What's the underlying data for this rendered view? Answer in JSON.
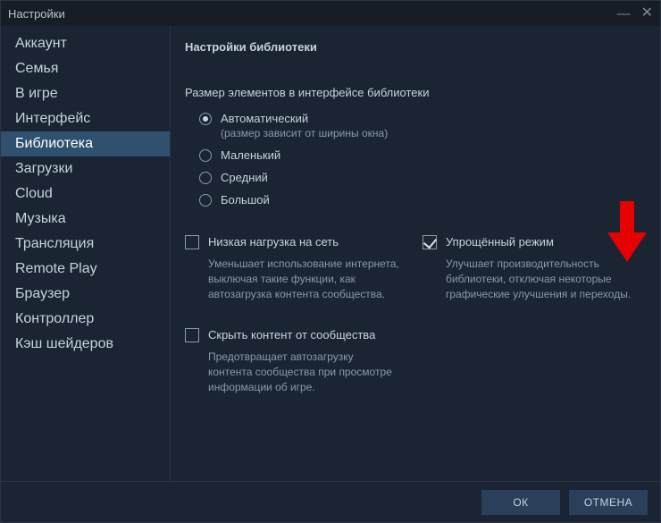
{
  "titlebar": {
    "title": "Настройки"
  },
  "sidebar": {
    "items": [
      {
        "label": "Аккаунт",
        "active": false
      },
      {
        "label": "Семья",
        "active": false
      },
      {
        "label": "В игре",
        "active": false
      },
      {
        "label": "Интерфейс",
        "active": false
      },
      {
        "label": "Библиотека",
        "active": true
      },
      {
        "label": "Загрузки",
        "active": false
      },
      {
        "label": "Cloud",
        "active": false
      },
      {
        "label": "Музыка",
        "active": false
      },
      {
        "label": "Трансляция",
        "active": false
      },
      {
        "label": "Remote Play",
        "active": false
      },
      {
        "label": "Браузер",
        "active": false
      },
      {
        "label": "Контроллер",
        "active": false
      },
      {
        "label": "Кэш шейдеров",
        "active": false
      }
    ]
  },
  "content": {
    "heading": "Настройки библиотеки",
    "size_section": {
      "label": "Размер элементов в интерфейсе библиотеки",
      "options": {
        "auto": {
          "label": "Автоматический",
          "sub": "(размер зависит от ширины окна)",
          "checked": true
        },
        "small": {
          "label": "Маленький",
          "checked": false
        },
        "medium": {
          "label": "Средний",
          "checked": false
        },
        "large": {
          "label": "Большой",
          "checked": false
        }
      }
    },
    "low_bandwidth": {
      "label": "Низкая нагрузка на сеть",
      "checked": false,
      "desc": "Уменьшает использование интернета, выключая такие функции, как автозагрузка контента сообщества."
    },
    "low_perf": {
      "label": "Упрощённый режим",
      "checked": true,
      "desc": "Улучшает производительность библиотеки, отключая некоторые графические улучшения и переходы."
    },
    "hide_community": {
      "label": "Скрыть контент от сообщества",
      "checked": false,
      "desc": "Предотвращает автозагрузку контента сообщества при просмотре информации об игре."
    }
  },
  "buttons": {
    "ok": "ОК",
    "cancel": "ОТМЕНА"
  },
  "annotation": {
    "color": "#e60000"
  }
}
